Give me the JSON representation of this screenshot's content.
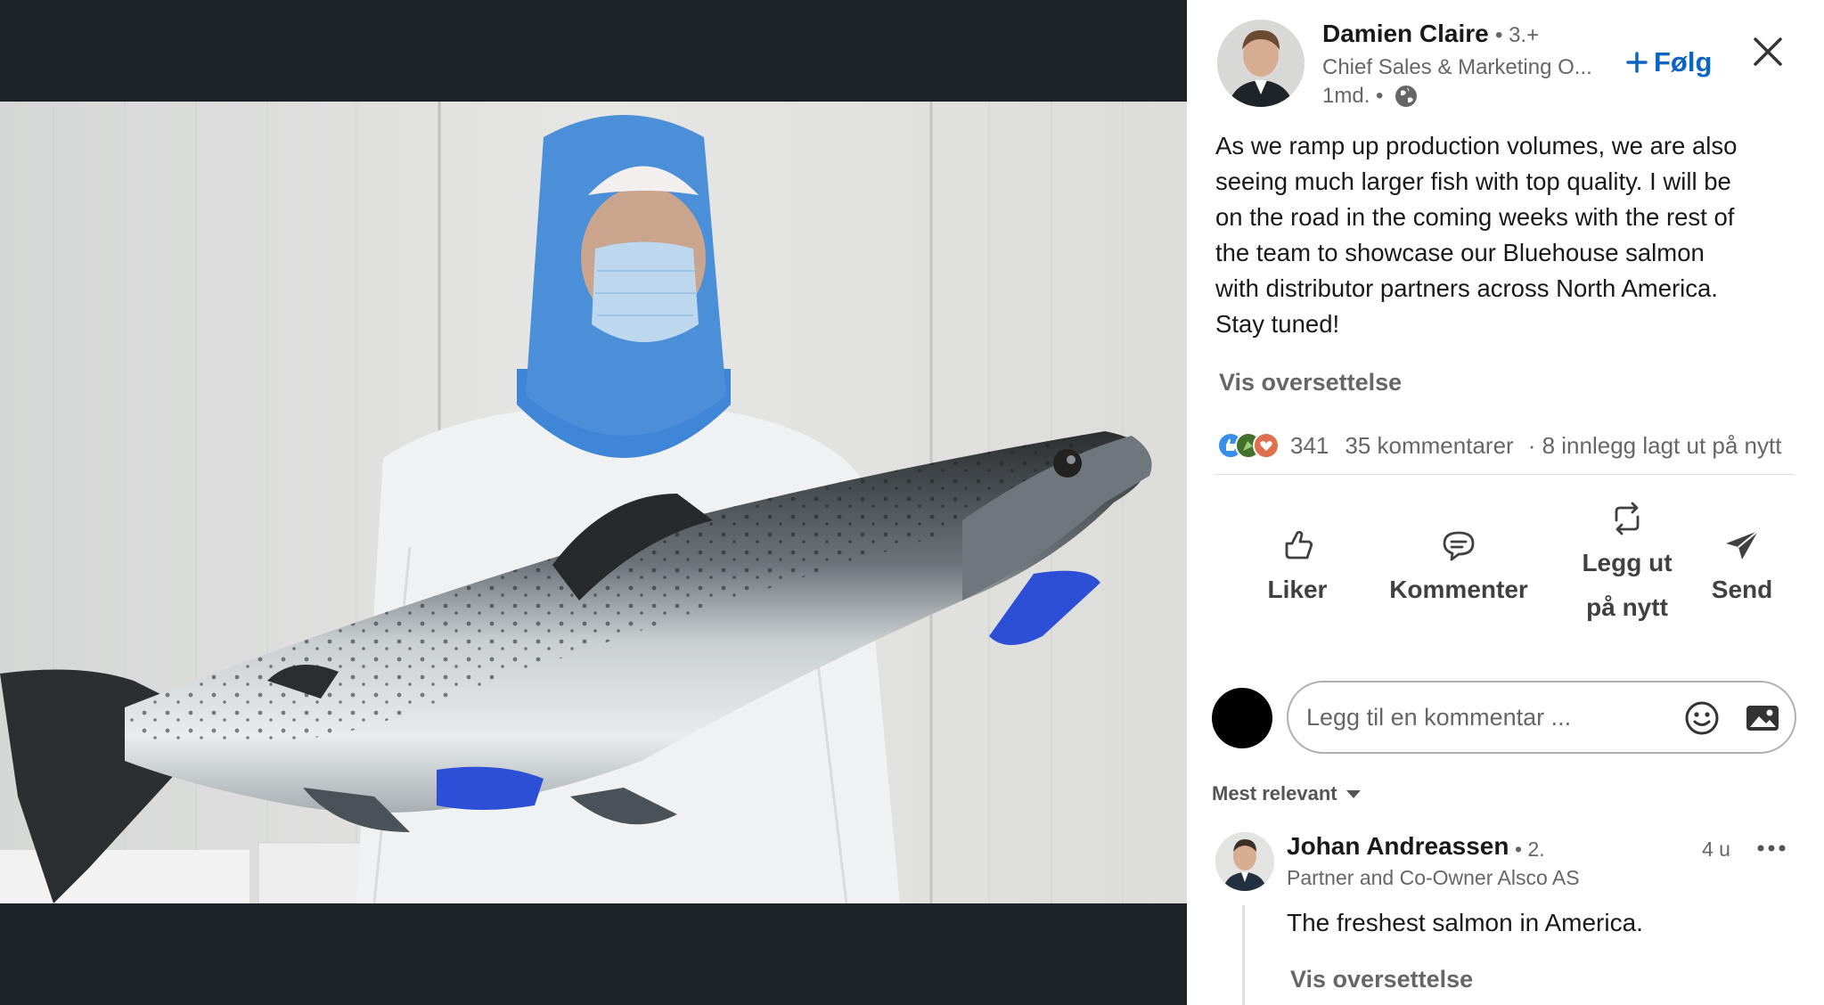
{
  "post": {
    "author": {
      "name": "Damien Claire",
      "degree": "• 3.+",
      "title": "Chief Sales & Marketing O...",
      "time": "1md. •",
      "avatar_icon": "person-avatar"
    },
    "follow_label": "Følg",
    "follow_icon": "plus-icon",
    "close_icon": "close-icon",
    "text_lines": [
      "As we ramp up production volumes, we are also",
      "seeing much larger fish with top quality. I will be",
      "on the road in the coming weeks with the rest of",
      "the team to showcase our Bluehouse salmon",
      "with distributor partners across North America.",
      "Stay tuned!"
    ],
    "translate_label": "Vis oversettelse",
    "media": {
      "icon": "salmon-photo"
    }
  },
  "social": {
    "reaction_icons": [
      "like-reaction-icon",
      "celebrate-reaction-icon",
      "love-reaction-icon"
    ],
    "reaction_count": "341",
    "comment_count": "35 kommentarer",
    "repost_count": "· 8 innlegg lagt ut på nytt"
  },
  "actions": {
    "like": "Liker",
    "comment": "Kommenter",
    "repost_line1": "Legg ut",
    "repost_line2": "på nytt",
    "send": "Send"
  },
  "comment_input": {
    "placeholder": "Legg til en kommentar ...",
    "emoji_icon": "emoji-icon",
    "image_icon": "image-icon"
  },
  "sort": {
    "label": "Mest relevant",
    "icon": "caret-down-icon"
  },
  "comments": [
    {
      "name": "Johan Andreassen",
      "degree": "• 2.",
      "headline": "Partner and Co-Owner Alsco AS",
      "time": "4 u",
      "text": "The freshest salmon in America.",
      "translate_label": "Vis oversettelse"
    }
  ],
  "colors": {
    "link_blue": "#0a66c2",
    "media_bg": "#1d2226",
    "hood_blue": "#4a8fd8"
  }
}
